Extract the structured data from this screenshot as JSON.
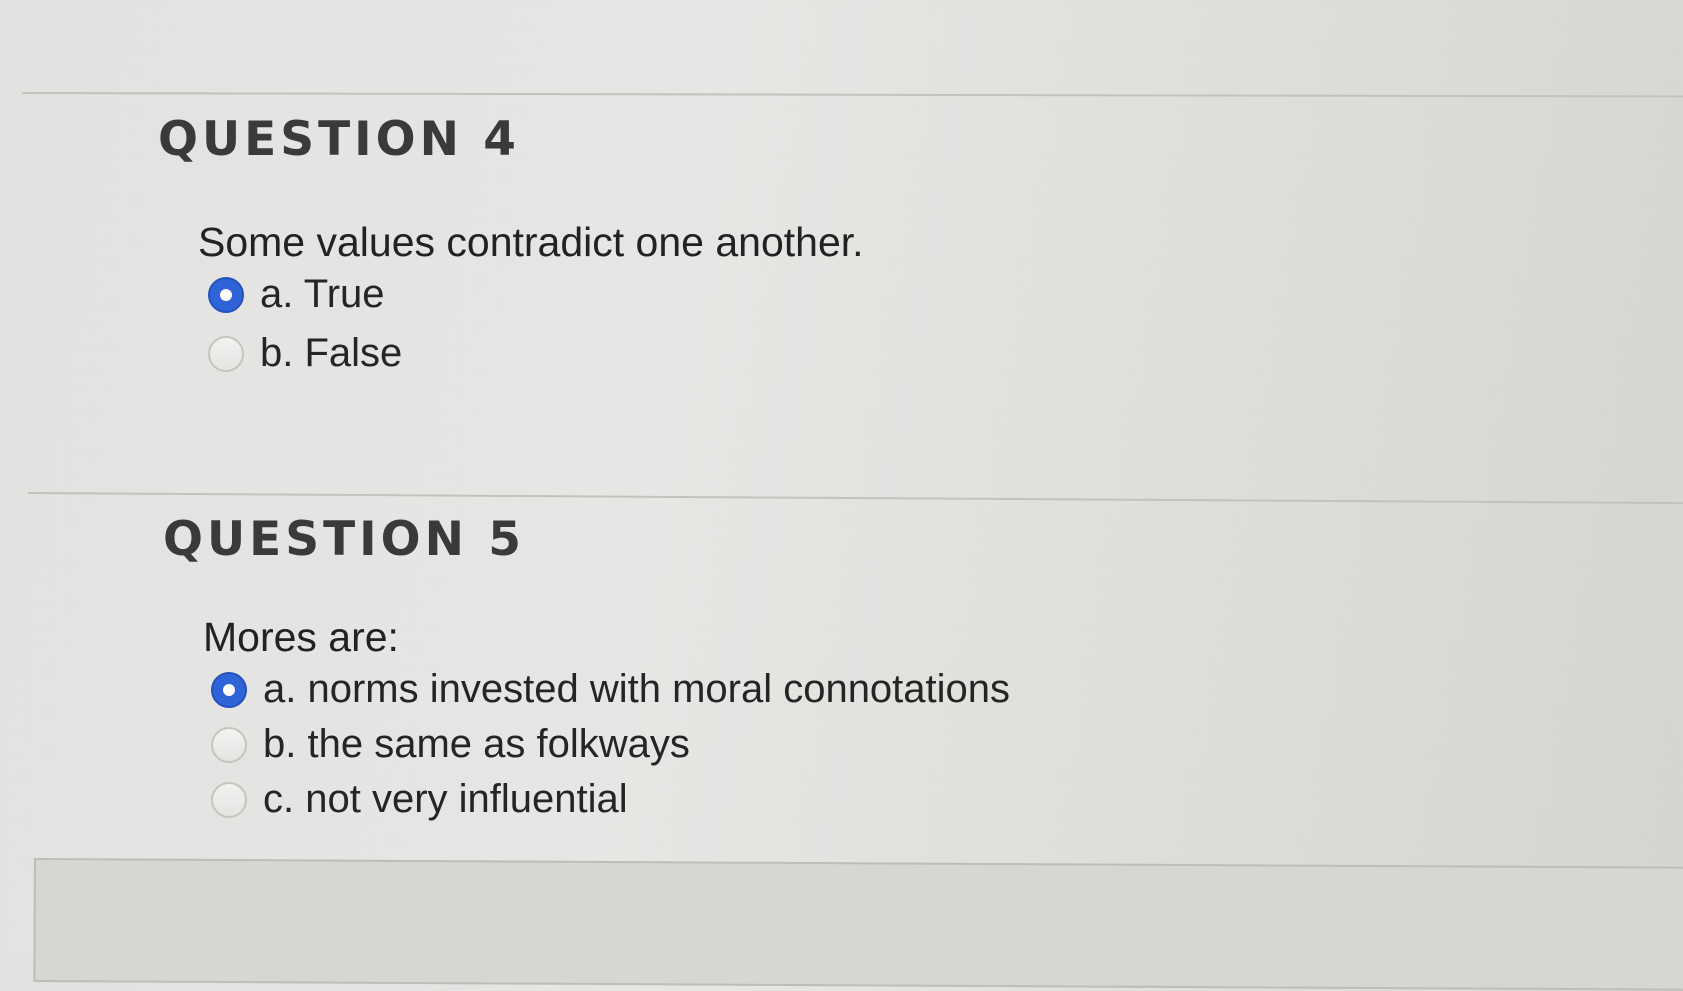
{
  "questions": [
    {
      "heading": "QUESTION 4",
      "text": "Some values contradict one another.",
      "options": [
        {
          "label": "a. True",
          "selected": true
        },
        {
          "label": "b. False",
          "selected": false
        }
      ]
    },
    {
      "heading": "QUESTION 5",
      "text": "Mores are:",
      "options": [
        {
          "label": "a. norms invested with moral connotations",
          "selected": true
        },
        {
          "label": "b. the same as folkways",
          "selected": false
        },
        {
          "label": "c. not very influential",
          "selected": false
        }
      ]
    }
  ],
  "colors": {
    "radio_selected": "#2f63d8",
    "background": "#e2e2e0"
  }
}
